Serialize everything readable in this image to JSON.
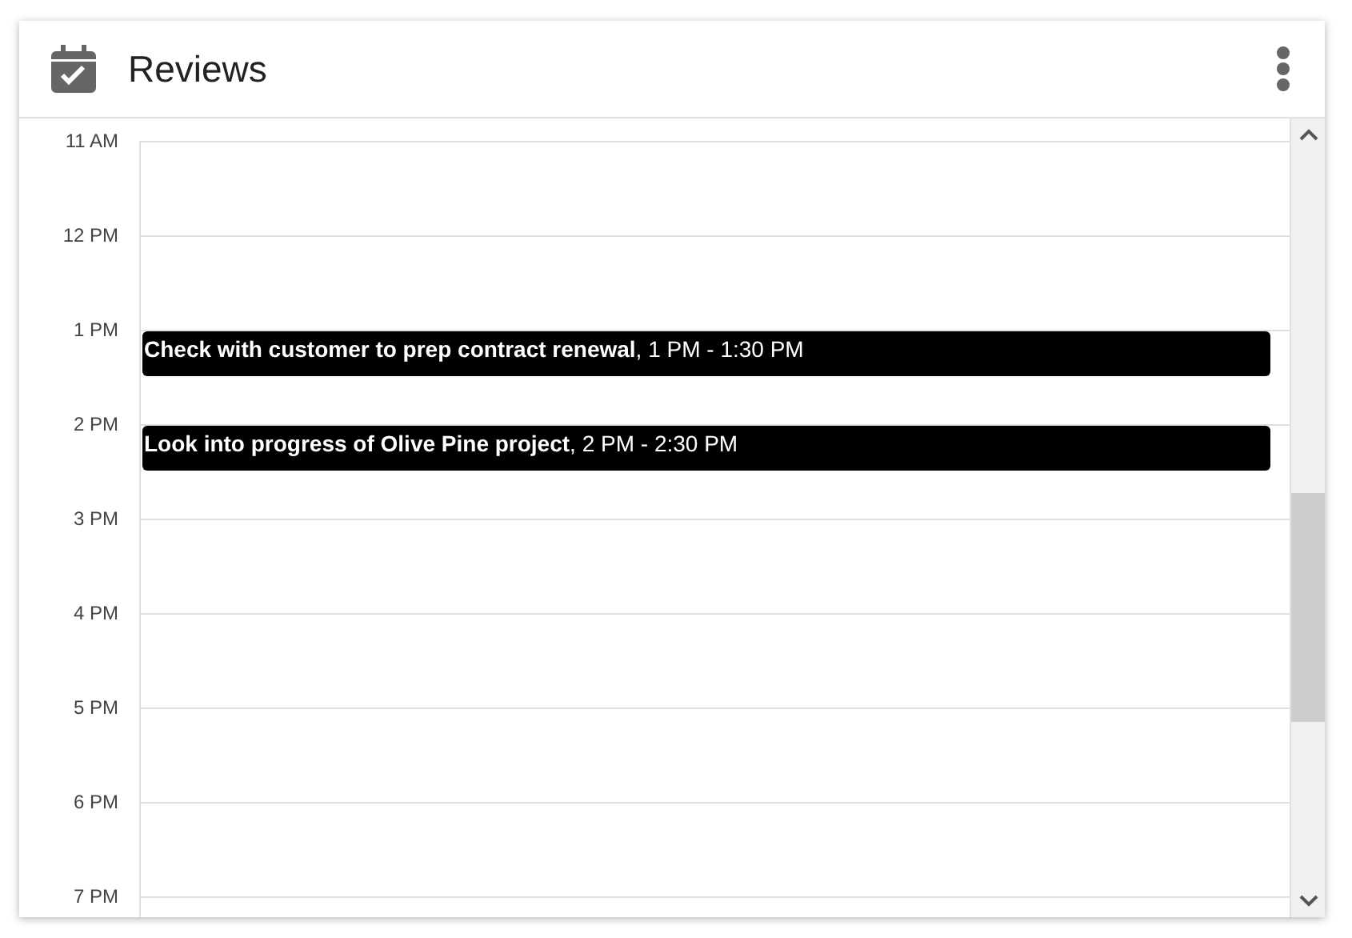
{
  "header": {
    "title": "Reviews"
  },
  "hours": [
    {
      "label": "11 AM"
    },
    {
      "label": "12 PM"
    },
    {
      "label": "1 PM",
      "events": [
        {
          "text": "**Check with customer to prep contract renewal**, 1 PM - 1:30 PM"
        }
      ]
    },
    {
      "label": "2 PM",
      "events": [
        {
          "text": "**Look into progress of Olive Pine project**, 2 PM - 2:30 PM"
        }
      ]
    },
    {
      "label": "3 PM"
    },
    {
      "label": "4 PM"
    },
    {
      "label": "5 PM"
    },
    {
      "label": "6 PM"
    },
    {
      "label": "7 PM"
    }
  ]
}
